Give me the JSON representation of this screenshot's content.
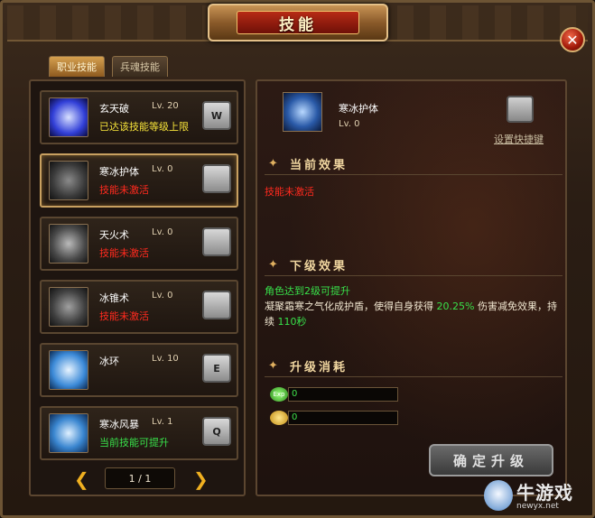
{
  "window": {
    "title": "技能",
    "close_label": "✕"
  },
  "tabs": [
    {
      "label": "职业技能",
      "active": true
    },
    {
      "label": "兵魂技能",
      "active": false
    }
  ],
  "skills": [
    {
      "name": "玄天破",
      "level": "Lv. 20",
      "status": "已达该技能等级上限",
      "status_color": "yellow",
      "key": "W",
      "icon": "lightning-skill-icon"
    },
    {
      "name": "寒冰护体",
      "level": "Lv. 0",
      "status": "技能未激活",
      "status_color": "red",
      "key": "",
      "icon": "ice-armor-skill-icon",
      "selected": true
    },
    {
      "name": "天火术",
      "level": "Lv. 0",
      "status": "技能未激活",
      "status_color": "red",
      "key": "",
      "icon": "skyfire-skill-icon"
    },
    {
      "name": "冰锥术",
      "level": "Lv. 0",
      "status": "技能未激活",
      "status_color": "red",
      "key": "",
      "icon": "ice-cone-skill-icon"
    },
    {
      "name": "冰环",
      "level": "Lv. 10",
      "status": "",
      "status_color": "",
      "key": "E",
      "icon": "ice-ring-skill-icon"
    },
    {
      "name": "寒冰风暴",
      "level": "Lv. 1",
      "status": "当前技能可提升",
      "status_color": "green",
      "key": "Q",
      "icon": "ice-storm-skill-icon"
    }
  ],
  "pager": {
    "prev": "❮",
    "next": "❯",
    "text": "1 / 1"
  },
  "detail": {
    "name": "寒冰护体",
    "level": "Lv. 0",
    "shortcut_link": "设置快捷键",
    "current_effect_title": "当前效果",
    "current_effect": "技能未激活",
    "next_effect_title": "下级效果",
    "next_condition": "角色达到2级可提升",
    "next_desc_a": "凝聚霜寒之气化成护盾，使得自身获得",
    "next_desc_pct": "20.25%",
    "next_desc_b": "伤害减免效果，持续",
    "next_desc_dur": "110秒",
    "cost_title": "升级消耗",
    "exp_label": "Exp",
    "exp_cost": "0",
    "gold_cost": "0",
    "confirm_label": "确定升级"
  },
  "watermark": {
    "brand": "牛游戏",
    "url": "newyx.net"
  }
}
